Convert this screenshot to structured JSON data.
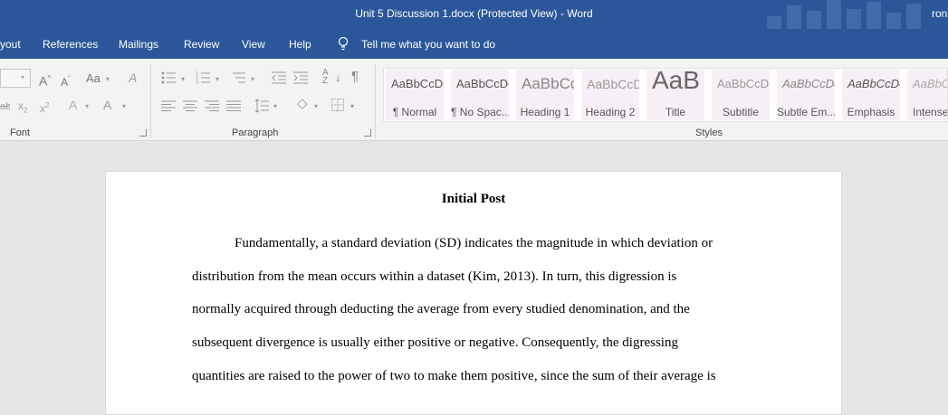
{
  "window": {
    "title": "Unit 5 Discussion 1.docx (Protected View)  -  Word",
    "user": "ron"
  },
  "menu": {
    "items": [
      "yout",
      "References",
      "Mailings",
      "Review",
      "View",
      "Help"
    ],
    "tell_me": "Tell me what you want to do"
  },
  "ribbon": {
    "font_group_label": "Font",
    "paragraph_group_label": "Paragraph",
    "styles_group_label": "Styles",
    "font_glyphs": {
      "grow": "A",
      "shrink": "A",
      "change_case": "Aa",
      "clear": "A",
      "subscript": "x",
      "subscript_suffix": "2",
      "superscript": "x",
      "superscript_suffix": "2",
      "effects": "A",
      "color": "A",
      "strike": "abc"
    },
    "styles": [
      {
        "sample": "AaBbCcDc",
        "label": "¶ Normal"
      },
      {
        "sample": "AaBbCcDc",
        "label": "¶ No Spac..."
      },
      {
        "sample": "AaBbCc",
        "label": "Heading 1"
      },
      {
        "sample": "AaBbCcD",
        "label": "Heading 2"
      },
      {
        "sample": "AaB",
        "label": "Title"
      },
      {
        "sample": "AaBbCcD",
        "label": "Subtitle"
      },
      {
        "sample": "AaBbCcDc",
        "label": "Subtle Em..."
      },
      {
        "sample": "AaBbCcDc",
        "label": "Emphasis"
      },
      {
        "sample": "AaBbCcDc",
        "label": "Intense"
      }
    ]
  },
  "document": {
    "title": "Initial Post",
    "lines": [
      "Fundamentally, a standard deviation (SD) indicates the magnitude in which deviation or",
      "distribution from the mean occurs within a dataset (Kim, 2013). In turn, this digression is",
      "normally acquired through deducting the average from every studied denomination, and the",
      "subsequent divergence is usually either positive or negative. Consequently, the digressing",
      "quantities are raised to the power of two to make them positive, since the sum of their average is"
    ]
  },
  "colors": {
    "accent": "#2b579a",
    "ribbon": "#f3f3f3",
    "canvas": "#e6e6e6"
  }
}
